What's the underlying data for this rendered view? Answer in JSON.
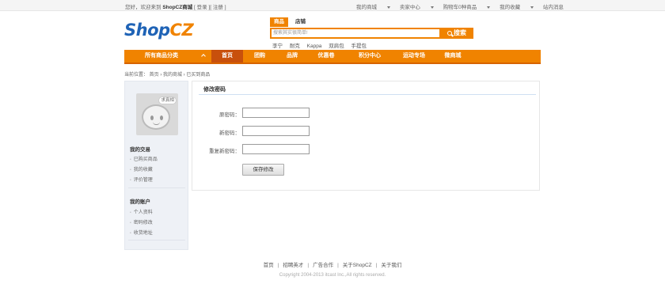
{
  "topbar": {
    "welcome": "您好，欢迎来到",
    "site_name": "ShopCZ商城",
    "login_links": "[ 登录 ][ 注册 ]",
    "links": [
      "我的商城",
      "卖家中心",
      "购物车0种商品",
      "我的收藏",
      "站内消息"
    ]
  },
  "logo": {
    "part_a": "Shop",
    "part_b": "CZ"
  },
  "search": {
    "tabs": [
      "商品",
      "店铺"
    ],
    "placeholder": "搜索其实很简单!",
    "button": "搜索",
    "hot": [
      "李宁",
      "耐克",
      "Kappa",
      "双肩包",
      "手提包"
    ]
  },
  "nav": {
    "category": "所有商品分类",
    "items": [
      "首页",
      "团购",
      "品牌",
      "优惠卷",
      "积分中心",
      "运动专场",
      "微商城"
    ]
  },
  "breadcrumb": "当前位置： 首页 › 我的商城 › 已买到商品",
  "sidebar": {
    "avatar_text": "求真相",
    "groups": [
      {
        "title": "我的交易",
        "items": [
          "已购买商品",
          "我的收藏",
          "评价管理"
        ]
      },
      {
        "title": "我的账户",
        "items": [
          "个人资料",
          "密码修改",
          "收货地址"
        ]
      }
    ]
  },
  "form": {
    "title": "修改密码",
    "fields": [
      "原密码：",
      "新密码：",
      "重复新密码："
    ],
    "submit": "保存修改"
  },
  "footer": {
    "links": [
      "首页",
      "招聘英才",
      "广告合作",
      "关于ShopCZ",
      "关于我们"
    ],
    "copyright": "Copyright 2004-2013 itcast Inc.,All rights reserved."
  },
  "colors": {
    "accent": "#f08300",
    "nav_active": "#c8500c",
    "logo_blue": "#1f63b6"
  }
}
